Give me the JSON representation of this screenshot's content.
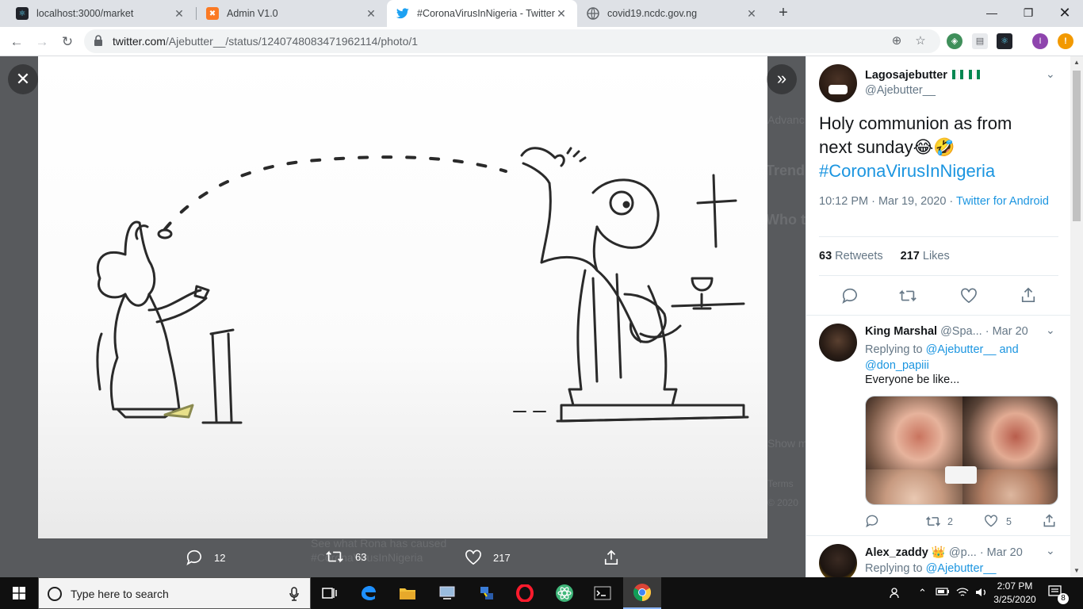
{
  "browser": {
    "tabs": [
      {
        "title": "localhost:3000/market",
        "icon": "react-icon"
      },
      {
        "title": "Admin V1.0",
        "icon": "xampp-icon"
      },
      {
        "title": "#CoronaVirusInNigeria - Twitter S",
        "icon": "twitter-icon",
        "active": true
      },
      {
        "title": "covid19.ncdc.gov.ng",
        "icon": "globe-icon"
      }
    ],
    "url_host": "twitter.com",
    "url_path": "/Ajebutter__/status/1240748083471962114/photo/1"
  },
  "viewer": {
    "actions": {
      "replies": "12",
      "retweets": "63",
      "likes": "217"
    },
    "background_text": {
      "line1": "See what Rona has caused",
      "line2": "#CoronaVirusInNigeria",
      "side1": "Advanc",
      "side2": "Trend",
      "side3": "Who t",
      "side4": "Show m",
      "side5": "Terms",
      "side6": "© 2020"
    }
  },
  "tweet": {
    "author_name": "Lagosajebutter",
    "author_handle": "@Ajebutter__",
    "text_line1": "Holy communion as from",
    "text_line2": "next sunday",
    "text_emoji": "😂🤣",
    "hashtag": "#CoronaVirusInNigeria",
    "time": "10:12 PM · Mar 19, 2020 · ",
    "source": "Twitter for Android",
    "retweets_count": "63",
    "retweets_label": "Retweets",
    "likes_count": "217",
    "likes_label": "Likes"
  },
  "replies": [
    {
      "name": "King Marshal",
      "handle": "@Spa...",
      "date": "· Mar 20",
      "replying_prefix": "Replying to ",
      "replying_to": "@Ajebutter__ and @don_papiii",
      "replying_to_1": "@Ajebutter__",
      "replying_and": " and",
      "replying_to_2": "@don_papiii",
      "text": "Everyone be like...",
      "retweets": "2",
      "likes": "5"
    },
    {
      "name": "Alex_zaddy",
      "badge": "👑",
      "handle": "@p...",
      "date": "· Mar 20",
      "replying_prefix": "Replying to ",
      "replying_to": "@Ajebutter__"
    }
  ],
  "taskbar": {
    "search_placeholder": "Type here to search",
    "time": "2:07 PM",
    "date": "3/25/2020",
    "notifications": "8"
  },
  "colors": {
    "twitter_blue": "#1b95e0",
    "chrome_tabstrip": "#dee1e6",
    "overlay": "#585a5d",
    "taskbar": "#101010"
  }
}
